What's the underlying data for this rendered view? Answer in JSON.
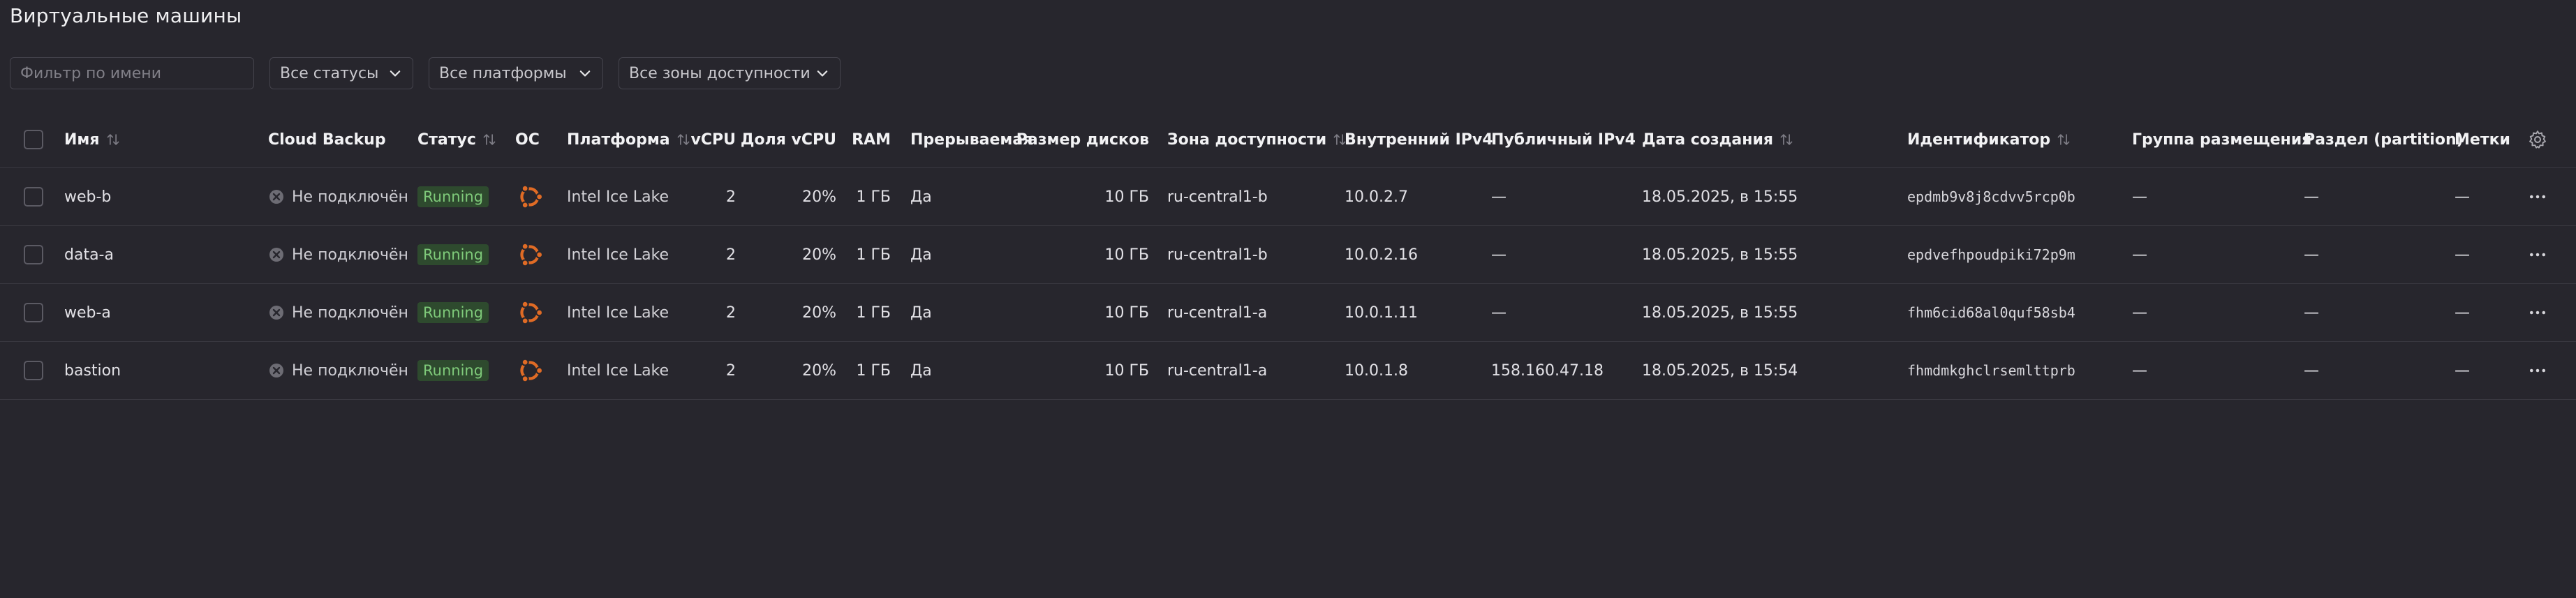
{
  "page": {
    "title": "Виртуальные машины"
  },
  "filters": {
    "name_placeholder": "Фильтр по имени",
    "status": "Все статусы",
    "platform": "Все платформы",
    "zones": "Все зоны доступности"
  },
  "columns": {
    "name": "Имя",
    "backup": "Cloud Backup",
    "status": "Статус",
    "os": "ОС",
    "platform": "Платформа",
    "vcpu": "vCPU",
    "vcpu_share": "Доля vCPU",
    "ram": "RAM",
    "preemptible": "Прерываемая",
    "disk_size": "Размер дисков",
    "zone": "Зона доступности",
    "ip_internal": "Внутренний IPv4",
    "ip_public": "Публичный IPv4",
    "created": "Дата создания",
    "id": "Идентификатор",
    "placement_group": "Группа размещения",
    "partition": "Раздел (partition)",
    "labels": "Метки"
  },
  "rows": [
    {
      "name": "web-b",
      "backup": "Не подключён",
      "status": "Running",
      "os": "ubuntu-icon",
      "platform": "Intel Ice Lake",
      "vcpu": "2",
      "vcpu_share": "20%",
      "ram": "1 ГБ",
      "preemptible": "Да",
      "disk_size": "10 ГБ",
      "zone": "ru-central1-b",
      "ip_internal": "10.0.2.7",
      "ip_public": "—",
      "created": "18.05.2025, в 15:55",
      "id": "epdmb9v8j8cdvv5rcp0b",
      "placement_group": "—",
      "partition": "—",
      "labels": "—"
    },
    {
      "name": "data-a",
      "backup": "Не подключён",
      "status": "Running",
      "os": "ubuntu-icon",
      "platform": "Intel Ice Lake",
      "vcpu": "2",
      "vcpu_share": "20%",
      "ram": "1 ГБ",
      "preemptible": "Да",
      "disk_size": "10 ГБ",
      "zone": "ru-central1-b",
      "ip_internal": "10.0.2.16",
      "ip_public": "—",
      "created": "18.05.2025, в 15:55",
      "id": "epdvefhpoudpiki72p9m",
      "placement_group": "—",
      "partition": "—",
      "labels": "—"
    },
    {
      "name": "web-a",
      "backup": "Не подключён",
      "status": "Running",
      "os": "ubuntu-icon",
      "platform": "Intel Ice Lake",
      "vcpu": "2",
      "vcpu_share": "20%",
      "ram": "1 ГБ",
      "preemptible": "Да",
      "disk_size": "10 ГБ",
      "zone": "ru-central1-a",
      "ip_internal": "10.0.1.11",
      "ip_public": "—",
      "created": "18.05.2025, в 15:55",
      "id": "fhm6cid68al0quf58sb4",
      "placement_group": "—",
      "partition": "—",
      "labels": "—"
    },
    {
      "name": "bastion",
      "backup": "Не подключён",
      "status": "Running",
      "os": "ubuntu-icon",
      "platform": "Intel Ice Lake",
      "vcpu": "2",
      "vcpu_share": "20%",
      "ram": "1 ГБ",
      "preemptible": "Да",
      "disk_size": "10 ГБ",
      "zone": "ru-central1-a",
      "ip_internal": "10.0.1.8",
      "ip_public": "158.160.47.18",
      "created": "18.05.2025, в 15:54",
      "id": "fhmdmkghclrsemlttprb",
      "placement_group": "—",
      "partition": "—",
      "labels": "—"
    }
  ],
  "colors": {
    "background": "#27262d",
    "status_running_bg": "#2e4a2e",
    "status_running_text": "#7fca7a",
    "ubuntu": "#e06b25"
  }
}
